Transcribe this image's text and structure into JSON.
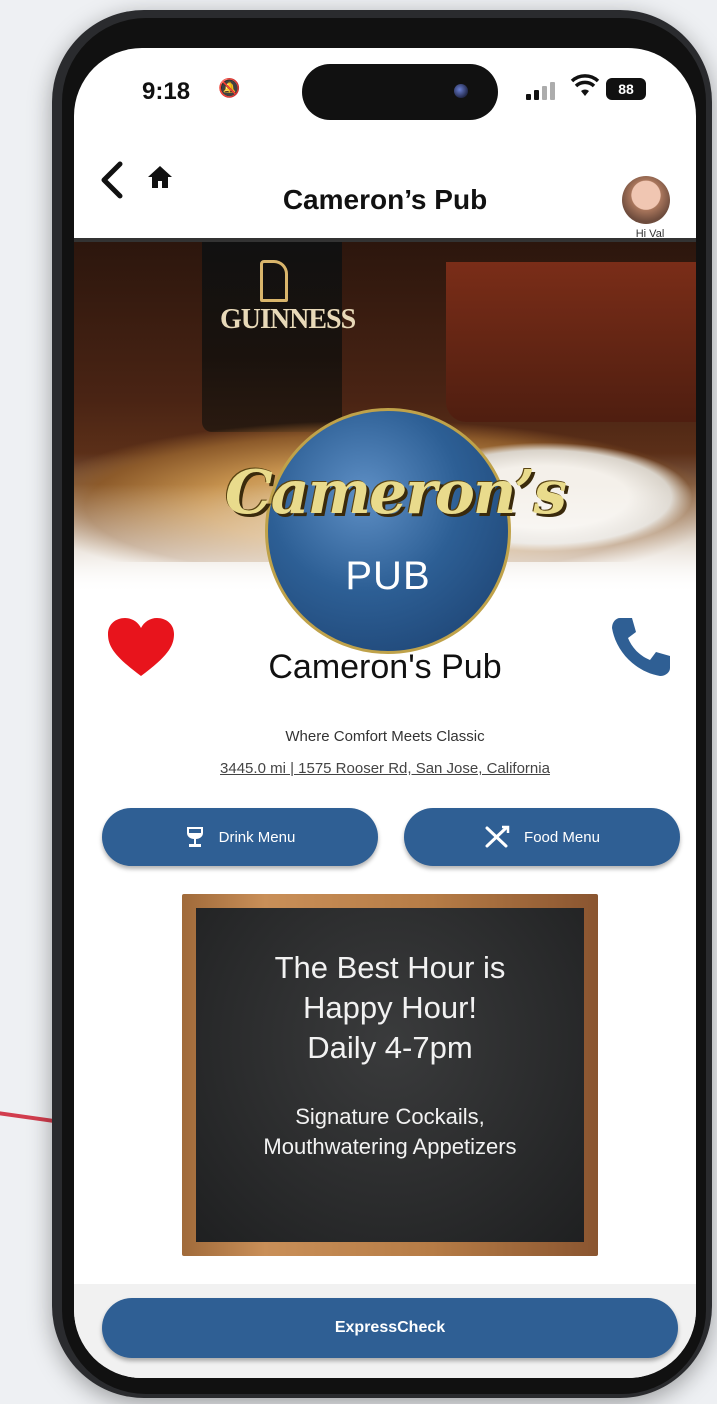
{
  "status_bar": {
    "time": "9:18",
    "battery": "88"
  },
  "nav": {
    "title": "Cameron’s Pub",
    "avatar_label": "Hi Val"
  },
  "hero": {
    "glass_brand": "GUINNESS",
    "logo_script": "Cameron’s",
    "logo_pub": "PUB"
  },
  "business": {
    "name": "Cameron's Pub",
    "tagline": "Where Comfort Meets Classic",
    "address": "3445.0 mi | 1575 Rooser Rd, San Jose, California"
  },
  "actions": {
    "drink_menu": "Drink Menu",
    "food_menu": "Food Menu"
  },
  "promo": {
    "line1": "The Best Hour is",
    "line2": "Happy Hour!",
    "line3": "Daily 4-7pm",
    "sub1": "Signature Cockails,",
    "sub2": "Mouthwatering Appetizers"
  },
  "footer": {
    "express_check": "ExpressCheck"
  },
  "colors": {
    "primary": "#2f5f94",
    "heart": "#e8141c"
  },
  "icons": [
    "back-arrow-icon",
    "home-icon",
    "heart-icon",
    "phone-icon",
    "wine-glass-icon",
    "fork-knife-icon",
    "wifi-icon",
    "signal-icon",
    "bell-icon"
  ]
}
